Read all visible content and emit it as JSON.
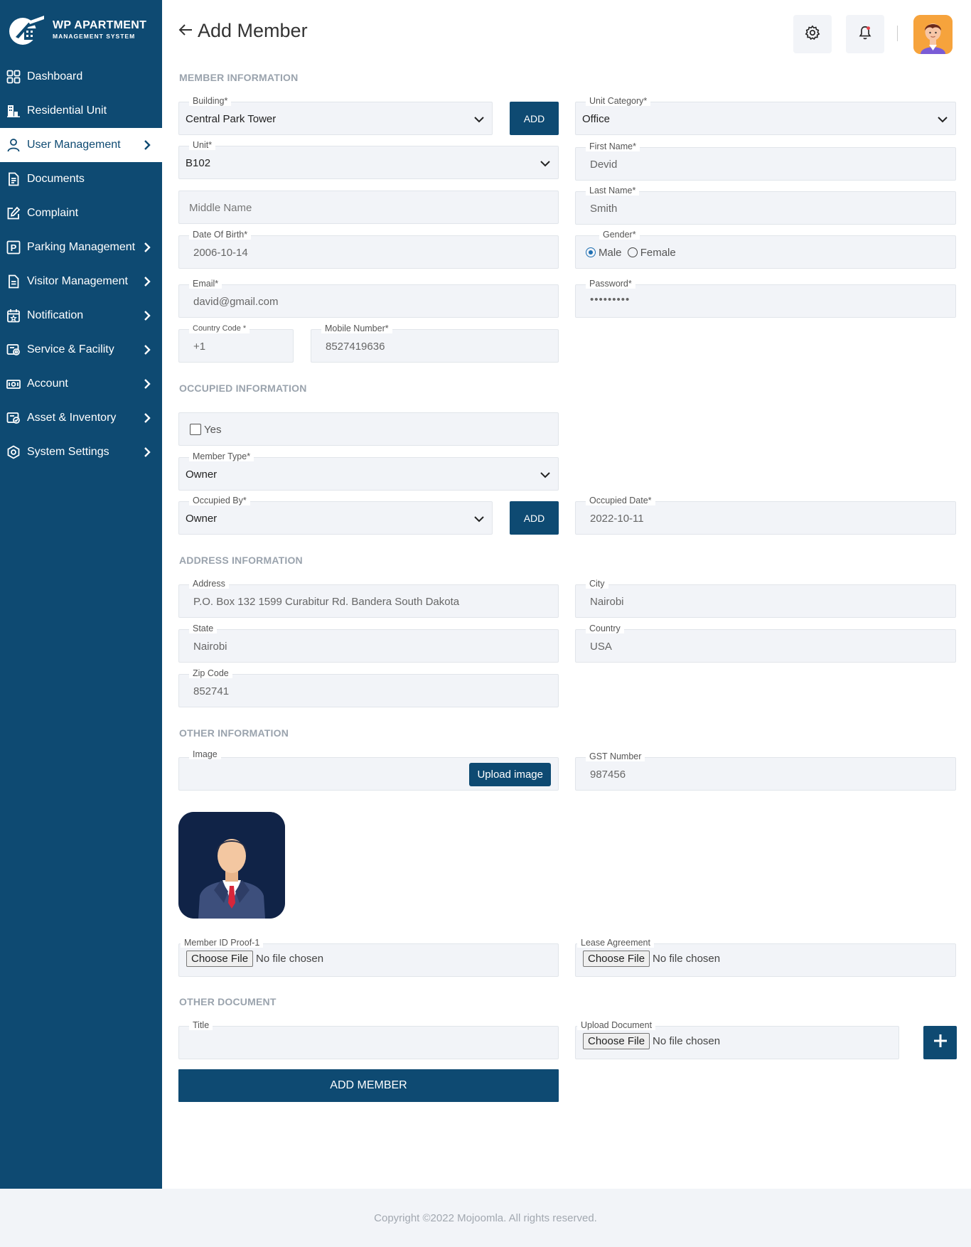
{
  "brand": {
    "title": "WP APARTMENT",
    "subtitle": "MANAGEMENT SYSTEM"
  },
  "sidebar": {
    "items": [
      {
        "label": "Dashboard",
        "icon": "dashboard-icon",
        "chevron": false
      },
      {
        "label": "Residential Unit",
        "icon": "building-icon",
        "chevron": false
      },
      {
        "label": "User Management",
        "icon": "user-icon",
        "chevron": true,
        "active": true
      },
      {
        "label": "Documents",
        "icon": "document-icon",
        "chevron": false
      },
      {
        "label": "Complaint",
        "icon": "edit-icon",
        "chevron": false
      },
      {
        "label": "Parking Management",
        "icon": "parking-icon",
        "chevron": true
      },
      {
        "label": "Visitor Management",
        "icon": "clipboard-icon",
        "chevron": true
      },
      {
        "label": "Notification",
        "icon": "calendar-icon",
        "chevron": true
      },
      {
        "label": "Service & Facility",
        "icon": "service-icon",
        "chevron": true
      },
      {
        "label": "Account",
        "icon": "money-icon",
        "chevron": true
      },
      {
        "label": "Asset & Inventory",
        "icon": "asset-icon",
        "chevron": true
      },
      {
        "label": "System Settings",
        "icon": "settings-icon",
        "chevron": true
      }
    ]
  },
  "header": {
    "title": "Add Member"
  },
  "sections": {
    "member": "MEMBER INFORMATION",
    "occupied": "OCCUPIED INFORMATION",
    "address": "ADDRESS INFORMATION",
    "other": "OTHER INFORMATION",
    "other_document": "OTHER DOCUMENT"
  },
  "form": {
    "building": {
      "label": "Building*",
      "value": "Central Park Tower"
    },
    "add_label": "ADD",
    "unit_category": {
      "label": "Unit Category*",
      "value": "Office"
    },
    "unit": {
      "label": "Unit*",
      "value": "B102"
    },
    "first_name": {
      "label": "First Name*",
      "value": "Devid"
    },
    "middle_name": {
      "placeholder": "Middle Name"
    },
    "last_name": {
      "label": "Last Name*",
      "value": "Smith"
    },
    "dob": {
      "label": "Date Of Birth*",
      "value": "2006-10-14"
    },
    "gender": {
      "label": "Gender*",
      "options": [
        "Male",
        "Female"
      ],
      "selected": "Male"
    },
    "email": {
      "label": "Email*",
      "value": "david@gmail.com"
    },
    "password": {
      "label": "Password*",
      "value": "•••••••••"
    },
    "country_code": {
      "label": "Country Code *",
      "value": "+1"
    },
    "mobile": {
      "label": "Mobile Number*",
      "value": "8527419636"
    },
    "occupied_yes": {
      "label": "Yes",
      "checked": false
    },
    "member_type": {
      "label": "Member Type*",
      "value": "Owner"
    },
    "occupied_by": {
      "label": "Occupied By*",
      "value": "Owner"
    },
    "occupied_date": {
      "label": "Occupied Date*",
      "value": "2022-10-11"
    },
    "address": {
      "label": "Address",
      "value": "P.O. Box 132 1599 Curabitur Rd. Bandera South Dakota"
    },
    "city": {
      "label": "City",
      "value": "Nairobi"
    },
    "state": {
      "label": "State",
      "value": "Nairobi"
    },
    "country": {
      "label": "Country",
      "value": "USA"
    },
    "zip": {
      "label": "Zip Code",
      "value": "852741"
    },
    "image": {
      "label": "Image",
      "button": "Upload image"
    },
    "gst": {
      "label": "GST Number",
      "value": "987456"
    },
    "id_proof": {
      "label": "Member ID Proof-1"
    },
    "lease": {
      "label": "Lease Agreement"
    },
    "doc_title": {
      "label": "Title"
    },
    "upload_doc": {
      "label": "Upload Document"
    },
    "file": {
      "button": "Choose File",
      "status": "No file chosen"
    },
    "submit": "ADD MEMBER"
  },
  "colors": {
    "primary": "#0e4a72",
    "field_bg": "#f2f4f8",
    "section_title": "#9aa3ad"
  },
  "footer": {
    "text": "Copyright ©2022 Mojoomla. All rights reserved."
  }
}
